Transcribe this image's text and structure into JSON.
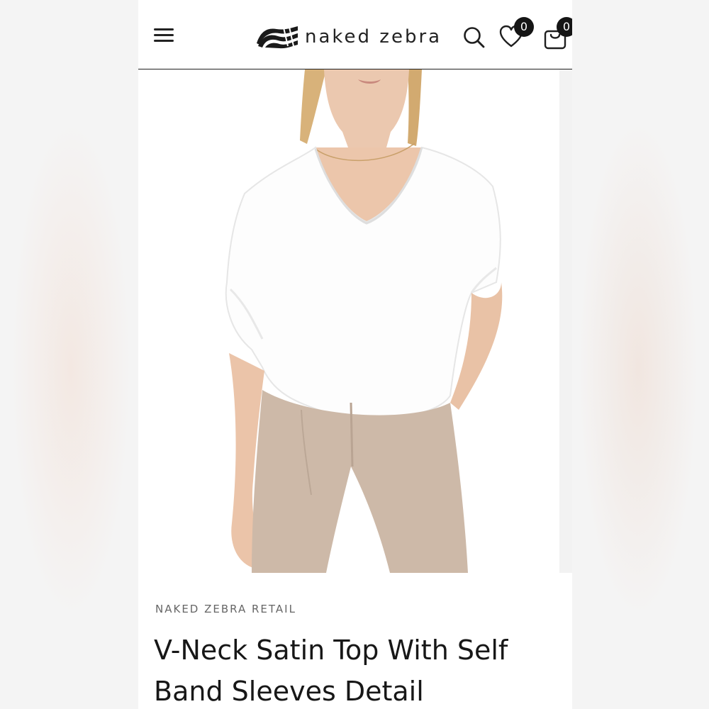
{
  "store": {
    "brand_name": "naked zebra",
    "wishlist_count": "0",
    "cart_count": "0"
  },
  "icons": {
    "menu": "hamburger-icon",
    "search": "search-icon",
    "wishlist": "heart-icon",
    "cart": "shopping-bag-icon"
  },
  "product": {
    "vendor": "NAKED ZEBRA RETAIL",
    "title": "V-Neck Satin Top With Self Band Sleeves Detail",
    "image_colors": {
      "top": "#ffffff",
      "pants": "#cbb7a6",
      "skin": "#e8c3aa",
      "hair": "#d9b47a"
    }
  }
}
